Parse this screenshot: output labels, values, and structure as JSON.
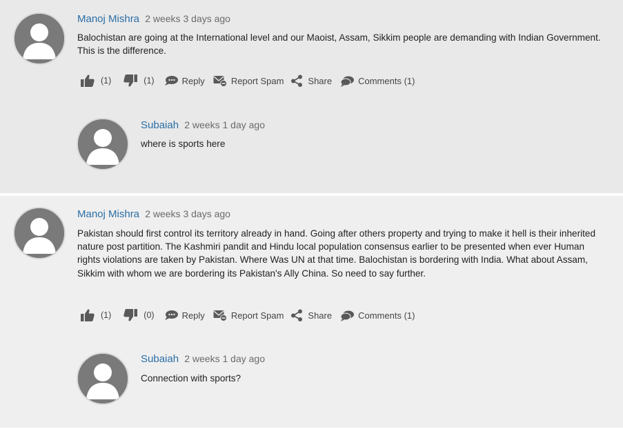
{
  "threads": [
    {
      "author": "Manoj Mishra",
      "time": "2 weeks 3 days ago",
      "text": "Balochistan are going at the International level and our Maoist, Assam, Sikkim people are demanding with Indian Government. This is the difference.",
      "likes": "(1)",
      "dislikes": "(1)",
      "reply_label": "Reply",
      "spam_label": "Report Spam",
      "share_label": "Share",
      "comments_label": "Comments (1)",
      "reply": {
        "author": "Subaiah",
        "time": "2 weeks 1 day ago",
        "text": "where is sports here"
      }
    },
    {
      "author": "Manoj Mishra",
      "time": "2 weeks 3 days ago",
      "text": "Pakistan should first control its territory already in hand. Going after others property and trying to make it hell is their inherited nature post partition. The Kashmiri pandit and Hindu local population consensus earlier to be presented when ever Human rights violations are taken by Pakistan. Where Was UN at that time. Balochistan is bordering with India. What about Assam, Sikkim with whom we are bordering its Pakistan's Ally China. So need to say further.",
      "likes": "(1)",
      "dislikes": "(0)",
      "reply_label": "Reply",
      "spam_label": "Report Spam",
      "share_label": "Share",
      "comments_label": "Comments (1)",
      "reply": {
        "author": "Subaiah",
        "time": "2 weeks 1 day ago",
        "text": "Connection with sports?"
      }
    }
  ],
  "icons": {
    "like": "thumbs-up-icon",
    "dislike": "thumbs-down-icon",
    "reply": "speech-bubble-icon",
    "spam": "report-spam-icon",
    "share": "share-icon",
    "comments": "comments-icon",
    "avatar": "default-user-avatar"
  },
  "colors": {
    "author_link": "#2a6ea6",
    "icon": "#595959",
    "block1_bg": "#e9e9e9",
    "block2_bg": "#efefef"
  }
}
